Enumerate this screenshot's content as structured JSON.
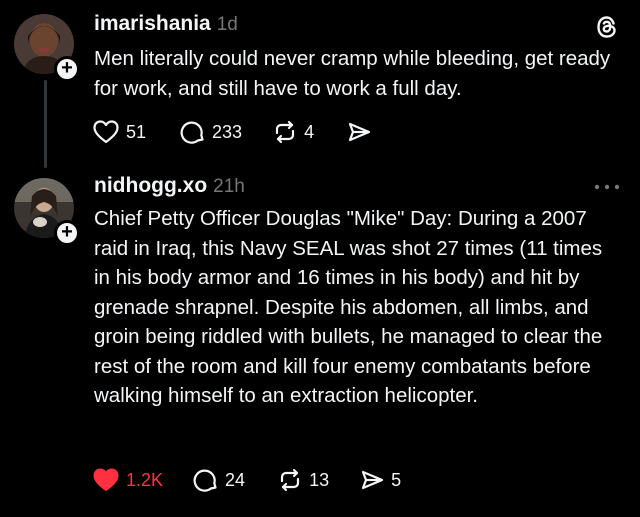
{
  "posts": [
    {
      "username": "imarishania",
      "timestamp": "1d",
      "text": "Men literally could never cramp while bleeding, get ready for work, and still have to work a full day.",
      "likes": "51",
      "replies": "233",
      "reposts": "4",
      "liked": false
    },
    {
      "username": "nidhogg.xo",
      "timestamp": "21h",
      "text": "Chief Petty Officer Douglas \"Mike\" Day: During a 2007 raid in Iraq, this Navy SEAL was shot 27 times (11 times in his body armor and 16 times in his body) and hit by grenade shrapnel. Despite his abdomen, all limbs, and groin being riddled with bullets, he managed to clear the rest of the room and kill four enemy combatants before walking himself to an extraction helicopter.",
      "likes": "1.2K",
      "replies": "24",
      "reposts": "13",
      "shares": "5",
      "liked": true
    }
  ],
  "colors": {
    "background": "#000000",
    "text": "#f3f5f7",
    "muted": "#777777",
    "like_active": "#ff3040"
  },
  "icons": [
    "threads-logo-icon",
    "more-options-icon",
    "heart-icon",
    "reply-icon",
    "repost-icon",
    "share-icon",
    "plus-icon"
  ]
}
